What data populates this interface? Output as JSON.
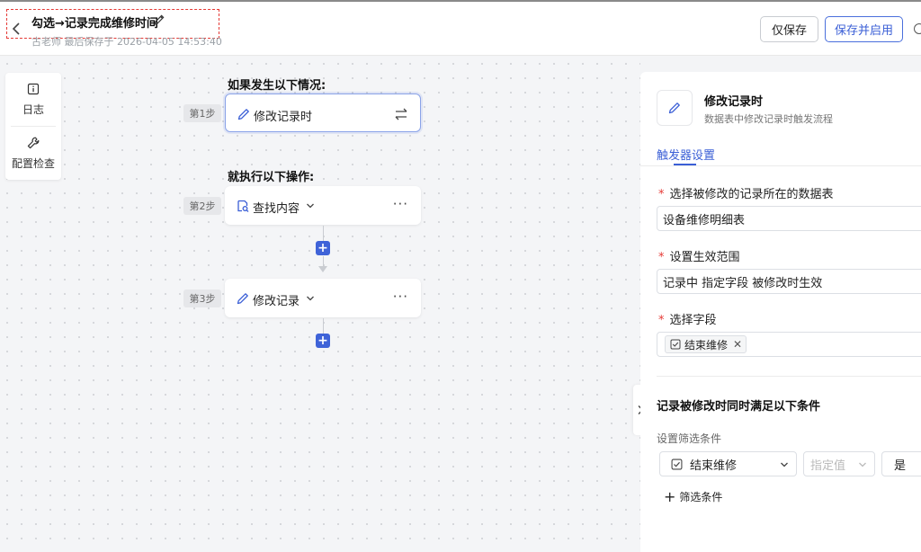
{
  "header": {
    "title": "勾选→记录完成维修时间",
    "subtitle": "古老师 最后保存于 2026-04-05 14:53:40",
    "save_label": "仅保存",
    "save_enable_label": "保存并启用"
  },
  "toolbar": {
    "log_label": "日志",
    "check_label": "配置检查"
  },
  "flow": {
    "if_label": "如果发生以下情况:",
    "then_label": "就执行以下操作:",
    "steps": [
      {
        "tag": "第1步",
        "label": "修改记录时"
      },
      {
        "tag": "第2步",
        "label": "查找内容"
      },
      {
        "tag": "第3步",
        "label": "修改记录"
      }
    ]
  },
  "panel": {
    "title": "修改记录时",
    "desc": "数据表中修改记录时触发流程",
    "tab": "触发器设置",
    "fields": {
      "table_label": "选择被修改的记录所在的数据表",
      "table_value": "设备维修明细表",
      "scope_label": "设置生效范围",
      "scope_value": "记录中 指定字段 被修改时生效",
      "field_label": "选择字段",
      "field_chip": "结束维修"
    },
    "condition_title": "记录被修改时同时满足以下条件",
    "condition_sub": "设置筛选条件",
    "condition": {
      "field": "结束维修",
      "operator_placeholder": "指定值",
      "value": "是"
    },
    "add_condition": "筛选条件"
  },
  "colors": {
    "accent": "#3b5fd6",
    "required": "#e53935",
    "highlight_box": "#e53935"
  }
}
